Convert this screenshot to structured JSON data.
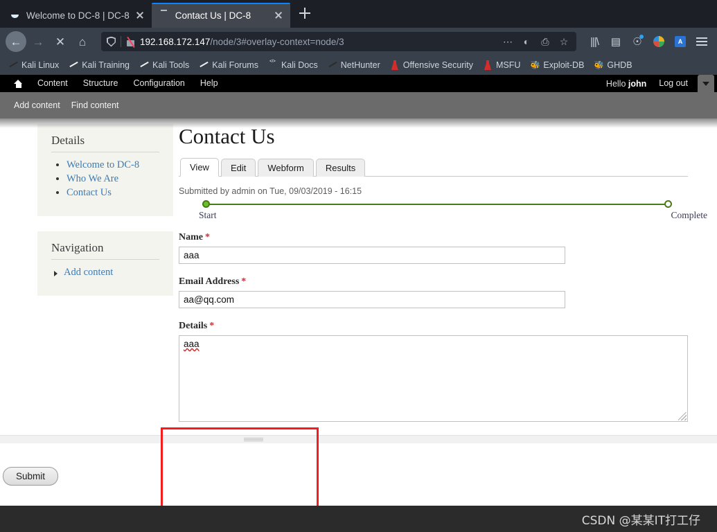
{
  "browser": {
    "tabs": [
      {
        "title": "Welcome to DC-8 | DC-8",
        "active": false,
        "icon": "drupal-drop-icon"
      },
      {
        "title": "Contact Us | DC-8",
        "active": true,
        "icon": "loading-dash-icon"
      }
    ],
    "new_tab_label": "+",
    "nav": {
      "back_label": "←",
      "forward_label": "→",
      "stop_label": "✕",
      "home_label": "⌂"
    },
    "url": {
      "host": "192.168.172.147",
      "path": "/node/3#overlay-context=node/3",
      "full": "192.168.172.147/node/3#overlay-context=node/3"
    },
    "url_actions": [
      "…",
      "pocket-icon",
      "translate-icon",
      "☆"
    ],
    "toolbar_icons": [
      "library-icon",
      "sidebar-icon",
      "account-icon",
      "pocket-circle-icon",
      "translate-page-icon",
      "menu-icon"
    ],
    "bookmarks": [
      {
        "label": "Kali Linux",
        "icon": "kali-dragon-red-icon"
      },
      {
        "label": "Kali Training",
        "icon": "kali-dragon-blue-icon"
      },
      {
        "label": "Kali Tools",
        "icon": "kali-dragon-blue-icon"
      },
      {
        "label": "Kali Forums",
        "icon": "kali-dragon-blue-icon"
      },
      {
        "label": "Kali Docs",
        "icon": "book-red-icon"
      },
      {
        "label": "NetHunter",
        "icon": "kali-dragon-red-icon"
      },
      {
        "label": "Offensive Security",
        "icon": "flask-red-icon"
      },
      {
        "label": "MSFU",
        "icon": "flask-red-icon"
      },
      {
        "label": "Exploit-DB",
        "icon": "bug-icon"
      },
      {
        "label": "GHDB",
        "icon": "bug-icon"
      }
    ]
  },
  "admin_toolbar": {
    "home_icon": "home-icon",
    "items": [
      "Content",
      "Structure",
      "Configuration",
      "Help"
    ],
    "greeting_prefix": "Hello ",
    "username": "john",
    "logout_label": "Log out",
    "drawer_items": [
      "Add content",
      "Find content"
    ]
  },
  "sidebar": {
    "blocks": [
      {
        "title": "Details",
        "type": "list",
        "items": [
          "Welcome to DC-8",
          "Who We Are",
          "Contact Us"
        ]
      },
      {
        "title": "Navigation",
        "type": "menu",
        "items": [
          "Add content"
        ]
      }
    ]
  },
  "main": {
    "page_title": "Contact Us",
    "tabs": [
      {
        "label": "View",
        "active": true
      },
      {
        "label": "Edit",
        "active": false
      },
      {
        "label": "Webform",
        "active": false
      },
      {
        "label": "Results",
        "active": false
      }
    ],
    "submitted_info": "Submitted by admin on Tue, 09/03/2019 - 16:15",
    "progress": {
      "start_label": "Start",
      "end_label": "Complete",
      "percent": 0,
      "line_color": "#4a7a18",
      "start_dot_color": "#6abf2a"
    },
    "form": {
      "fields": [
        {
          "label": "Name",
          "required_marker": "*",
          "type": "text",
          "value": "aaa",
          "placeholder": ""
        },
        {
          "label": "Email Address",
          "required_marker": "*",
          "type": "text",
          "value": "aa@qq.com",
          "placeholder": ""
        },
        {
          "label": "Details",
          "required_marker": "*",
          "type": "textarea",
          "value": "aaa",
          "placeholder": ""
        }
      ],
      "submit_label": "Submit"
    }
  },
  "annotation": {
    "highlight_color": "#f41c1c"
  },
  "watermark": {
    "text": "CSDN @某某IT打工仔"
  }
}
